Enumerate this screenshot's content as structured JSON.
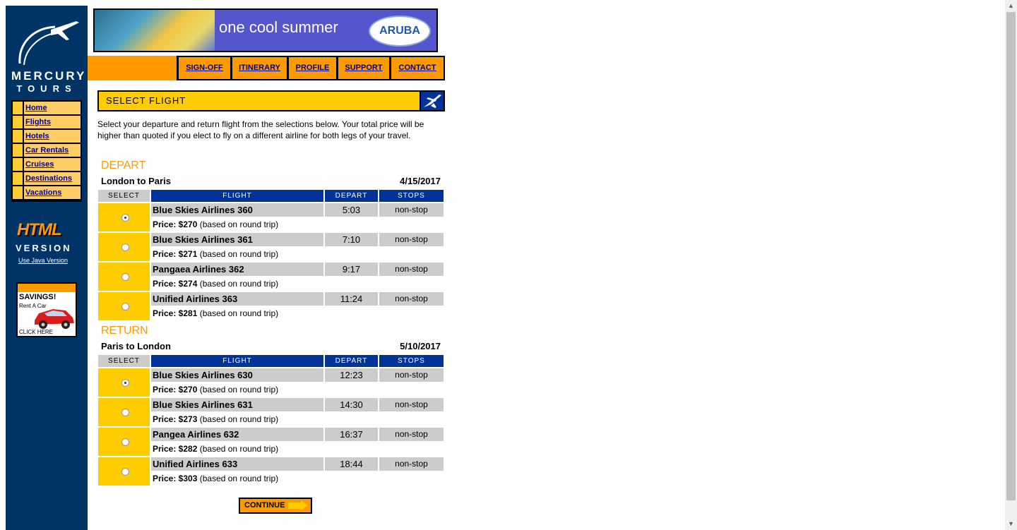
{
  "brand": {
    "word1": "MERCURY",
    "word2": "TOURS"
  },
  "sidebar": {
    "items": [
      {
        "label": "Home"
      },
      {
        "label": "Flights"
      },
      {
        "label": "Hotels"
      },
      {
        "label": "Car Rentals"
      },
      {
        "label": "Cruises"
      },
      {
        "label": "Destinations"
      },
      {
        "label": "Vacations"
      }
    ],
    "html_badge": "HTML",
    "version_label": "VERSION",
    "java_link": "Use Java Version",
    "ad": {
      "title": "SAVINGS!",
      "subtitle": "Rent A Car",
      "cta": "CLICK HERE"
    }
  },
  "banner": {
    "tagline": "one cool summer",
    "logo_text": "ARUBA"
  },
  "topnav": [
    {
      "label": "SIGN-OFF"
    },
    {
      "label": "ITINERARY"
    },
    {
      "label": "PROFILE"
    },
    {
      "label": "SUPPORT"
    },
    {
      "label": "CONTACT"
    }
  ],
  "page": {
    "title": "SELECT FLIGHT",
    "intro": "Select your departure and return flight from the selections below. Your total price will be higher than quoted if you elect to fly on a different airline for both legs of your travel."
  },
  "columns": {
    "select": "SELECT",
    "flight": "FLIGHT",
    "depart": "DEPART",
    "stops": "STOPS"
  },
  "depart": {
    "heading": "DEPART",
    "route": "London to Paris",
    "date": "4/15/2017",
    "flights": [
      {
        "name": "Blue Skies Airlines 360",
        "time": "5:03",
        "stops": "non-stop",
        "price": "Price: $270",
        "note": "(based on round trip)",
        "selected": true
      },
      {
        "name": "Blue Skies Airlines 361",
        "time": "7:10",
        "stops": "non-stop",
        "price": "Price: $271",
        "note": "(based on round trip)",
        "selected": false
      },
      {
        "name": "Pangaea Airlines 362",
        "time": "9:17",
        "stops": "non-stop",
        "price": "Price: $274",
        "note": "(based on round trip)",
        "selected": false
      },
      {
        "name": "Unified Airlines 363",
        "time": "11:24",
        "stops": "non-stop",
        "price": "Price: $281",
        "note": "(based on round trip)",
        "selected": false
      }
    ]
  },
  "return": {
    "heading": "RETURN",
    "route": "Paris to London",
    "date": "5/10/2017",
    "flights": [
      {
        "name": "Blue Skies Airlines 630",
        "time": "12:23",
        "stops": "non-stop",
        "price": "Price: $270",
        "note": "(based on round trip)",
        "selected": true
      },
      {
        "name": "Blue Skies Airlines 631",
        "time": "14:30",
        "stops": "non-stop",
        "price": "Price: $273",
        "note": "(based on round trip)",
        "selected": false
      },
      {
        "name": "Pangea Airlines 632",
        "time": "16:37",
        "stops": "non-stop",
        "price": "Price: $282",
        "note": "(based on round trip)",
        "selected": false
      },
      {
        "name": "Unified Airlines 633",
        "time": "18:44",
        "stops": "non-stop",
        "price": "Price: $303",
        "note": "(based on round trip)",
        "selected": false
      }
    ]
  },
  "continue_label": "CONTINUE",
  "colors": {
    "navy": "#003366",
    "orange": "#ff9900",
    "yellow": "#ffcc00",
    "header_blue": "#003399",
    "grey": "#cccccc",
    "link": "#000099"
  }
}
